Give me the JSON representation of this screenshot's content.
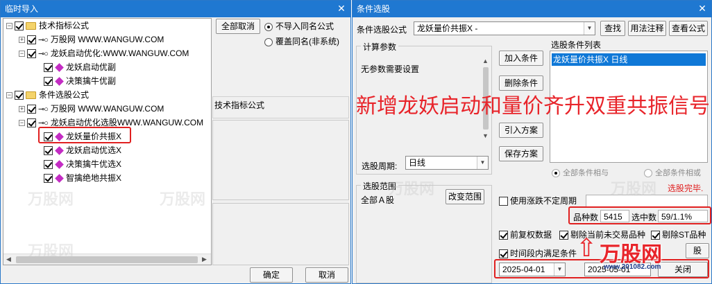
{
  "left_window": {
    "title": "临时导入",
    "close": "✕",
    "tree": [
      {
        "label": "技术指标公式",
        "type": "folder",
        "toggle": "−"
      },
      {
        "label": "万股网 WWW.WANGUW.COM",
        "type": "key",
        "toggle": "+"
      },
      {
        "label": "龙妖启动优化:WWW.WANGUW.COM",
        "type": "key",
        "toggle": "−"
      },
      {
        "label": "龙妖启动优副",
        "type": "item"
      },
      {
        "label": "决策擒牛优副",
        "type": "item"
      },
      {
        "label": "条件选股公式",
        "type": "folder",
        "toggle": "−"
      },
      {
        "label": "万股网 WWW.WANGUW.COM",
        "type": "key",
        "toggle": "+"
      },
      {
        "label": "龙妖启动优化选股WWW.WANGUW.COM",
        "type": "key",
        "toggle": "−"
      },
      {
        "label": "龙妖量价共振X",
        "type": "item"
      },
      {
        "label": "龙妖启动优选X",
        "type": "item"
      },
      {
        "label": "决策擒牛优选X",
        "type": "item"
      },
      {
        "label": "智擒绝地共振X",
        "type": "item"
      }
    ],
    "cancel_all": "全部取消",
    "radio_no_import": "不导入同名公式",
    "radio_overwrite": "覆盖同名(非系统)",
    "formula_label": "技术指标公式",
    "ok": "确定",
    "cancel": "取消"
  },
  "right_window": {
    "title": "条件选股",
    "close": "✕",
    "formula_label": "条件选股公式",
    "formula_value": "龙妖量价共振X  -",
    "btn_find": "查找",
    "btn_usage": "用法注释",
    "btn_view": "查看公式",
    "calc_params_title": "计算参数",
    "no_params": "无参数需要设置",
    "list_title": "选股条件列表",
    "list_items": [
      "龙妖量价共振X  日线"
    ],
    "btn_add": "加入条件",
    "btn_delete": "删除条件",
    "btn_import": "引入方案",
    "btn_save": "保存方案",
    "radio_all_and": "全部条件相与",
    "radio_all_or": "全部条件相或",
    "period_label": "选股周期:",
    "period_value": "日线",
    "scope_title": "选股范围",
    "scope_value": "全部Ａ股",
    "btn_change_scope": "改变范围",
    "done_text": "选股完毕.",
    "use_variable_period": "使用涨跌不定周期",
    "count_label": "品种数",
    "count_value": "5415",
    "selected_label": "选中数",
    "selected_value": "59/1.1%",
    "cb_pre_adjust": "前复权数据",
    "cb_exclude_untraded": "剔除当前未交易品种",
    "cb_exclude_st": "剔除ST品种",
    "cb_period_satisfied": "时间段内满足条件",
    "btn_partial": "股",
    "date_from": "2025-04-01",
    "date_to": "2025-05-01",
    "btn_close": "关闭",
    "dd_arrow": "▼"
  },
  "overlay": {
    "headline": "新增龙妖启动和量价齐升双重共振信号",
    "watermark_brand": "万股网",
    "watermark_url": "www.201082.com"
  },
  "colors": {
    "title_bar": "#1f78d1",
    "headline": "#e8242a",
    "highlight_box": "#e02020",
    "list_selection": "#0f78d7"
  }
}
